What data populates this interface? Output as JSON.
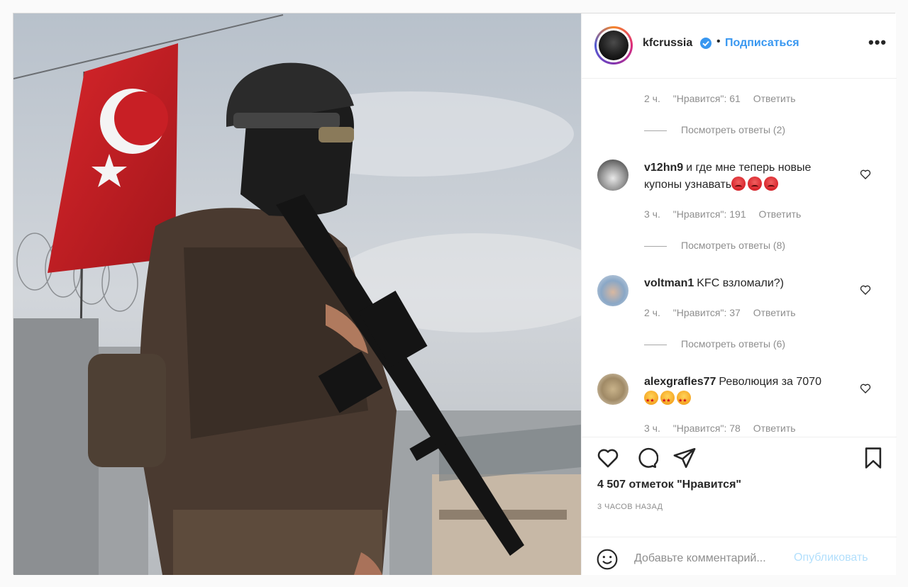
{
  "post": {
    "author": {
      "username": "kfcrussia",
      "verified": true,
      "separator": "•",
      "follow_label": "Подписаться",
      "more_label": "•••"
    },
    "photo": {
      "icon": "post-photo-soldier-flag"
    },
    "comments": [
      {
        "id": "top-partial",
        "time": "2 ч.",
        "likes": "\"Нравится\": 61",
        "reply_label": "Ответить",
        "view_replies": "Посмотреть ответы (2)"
      },
      {
        "id": "c1",
        "username": "v12hn9",
        "text": "и где мне теперь новые купоны узнавать",
        "emojis": [
          "angry-face",
          "angry-face",
          "angry-face"
        ],
        "time": "3 ч.",
        "likes": "\"Нравится\": 191",
        "reply_label": "Ответить",
        "view_replies": "Посмотреть ответы (8)"
      },
      {
        "id": "c2",
        "username": "voltman1",
        "text": "KFC взломали?)",
        "time": "2 ч.",
        "likes": "\"Нравится\": 37",
        "reply_label": "Ответить",
        "view_replies": "Посмотреть ответы (6)"
      },
      {
        "id": "c3",
        "username": "alexgrafles77",
        "text": "Революция за 7070",
        "emojis": [
          "star-struck-face",
          "star-struck-face",
          "star-struck-face"
        ],
        "time": "3 ч.",
        "likes": "\"Нравится\": 78",
        "reply_label": "Ответить"
      }
    ],
    "actions": {
      "like_icon": "heart-icon",
      "comment_icon": "comment-icon",
      "share_icon": "share-icon",
      "save_icon": "bookmark-icon"
    },
    "likes_count": "4 507 отметок \"Нравится\"",
    "time_ago": "3 ЧАСОВ НАЗАД",
    "add_comment": {
      "placeholder": "Добавьте комментарий...",
      "publish_label": "Опубликовать"
    },
    "colors": {
      "accent": "#3897f0",
      "publish_disabled": "#b2dffc",
      "muted_text": "#8e8e8e",
      "text": "#262626",
      "border": "#dbdbdb"
    }
  }
}
